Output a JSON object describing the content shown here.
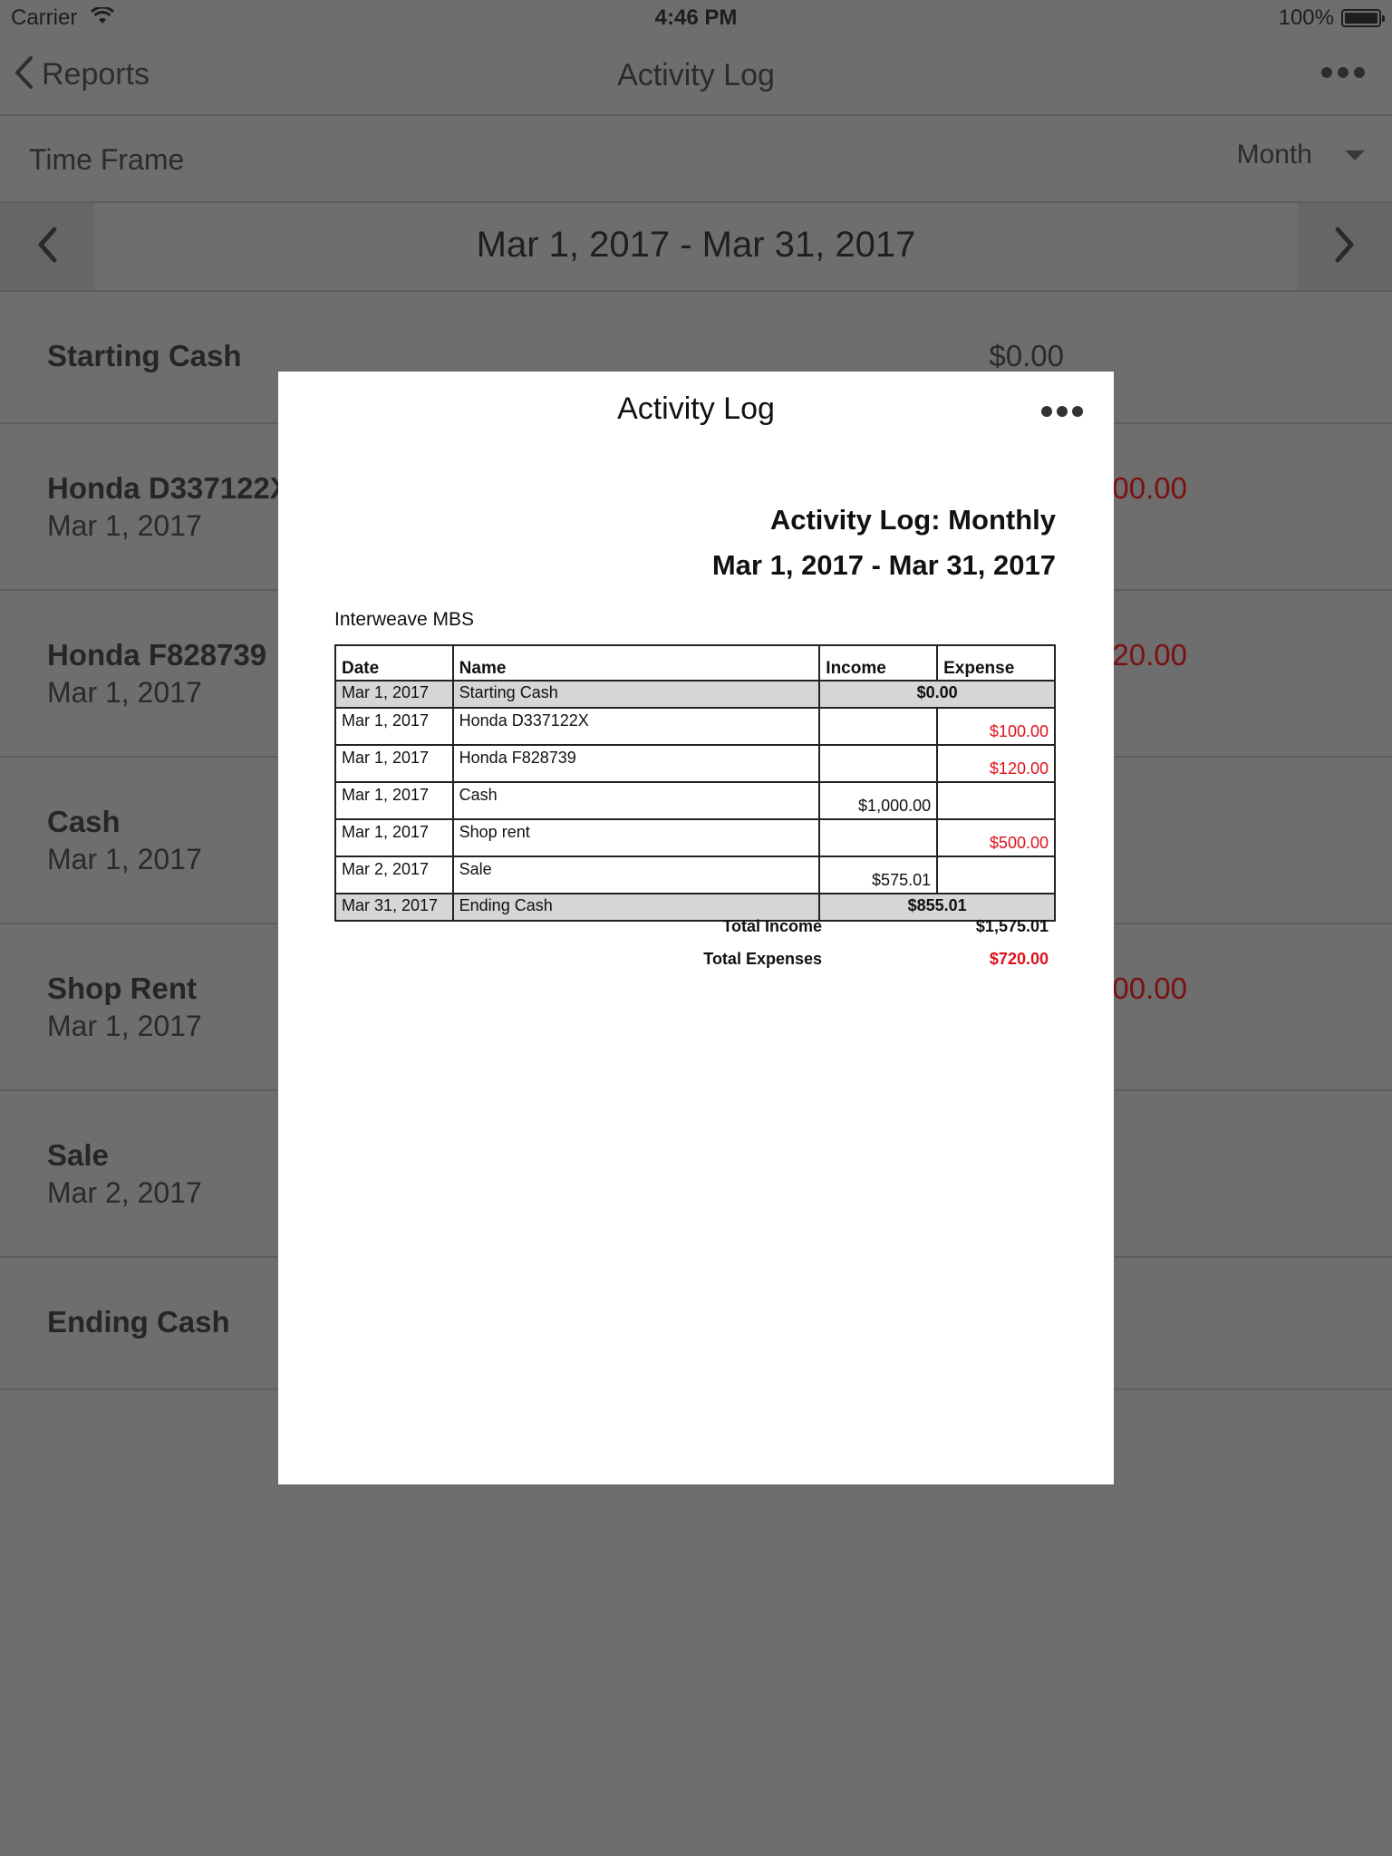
{
  "status_bar": {
    "carrier": "Carrier",
    "time": "4:46 PM",
    "battery": "100%"
  },
  "nav": {
    "back_label": "Reports",
    "title": "Activity Log"
  },
  "time_frame": {
    "label": "Time Frame",
    "value": "Month"
  },
  "date_range": "Mar 1, 2017 - Mar 31, 2017",
  "list": [
    {
      "name": "Starting Cash",
      "date": "",
      "amount": "$0.00",
      "expense": false
    },
    {
      "name": "Honda D337122X",
      "date": "Mar 1, 2017",
      "amount": "00.00",
      "expense": true
    },
    {
      "name": "Honda F828739",
      "date": "Mar 1, 2017",
      "amount": "20.00",
      "expense": true
    },
    {
      "name": "Cash",
      "date": "Mar 1, 2017",
      "amount": "",
      "expense": false
    },
    {
      "name": "Shop Rent",
      "date": "Mar 1, 2017",
      "amount": "00.00",
      "expense": true
    },
    {
      "name": "Sale",
      "date": "Mar 2, 2017",
      "amount": "",
      "expense": false
    },
    {
      "name": "Ending Cash",
      "date": "",
      "amount": "",
      "expense": false
    }
  ],
  "modal": {
    "title": "Activity Log",
    "report_title": "Activity Log: Monthly",
    "report_range": "Mar 1, 2017 - Mar 31, 2017",
    "company": "Interweave MBS",
    "columns": [
      "Date",
      "Name",
      "Income",
      "Expense"
    ],
    "starting_row": {
      "date": "Mar 1, 2017",
      "name": "Starting Cash",
      "amount": "$0.00"
    },
    "rows": [
      {
        "date": "Mar 1, 2017",
        "name": "Honda D337122X",
        "income": "",
        "expense": "$100.00"
      },
      {
        "date": "Mar 1, 2017",
        "name": "Honda F828739",
        "income": "",
        "expense": "$120.00"
      },
      {
        "date": "Mar 1, 2017",
        "name": "Cash",
        "income": "$1,000.00",
        "expense": ""
      },
      {
        "date": "Mar 1, 2017",
        "name": "Shop rent",
        "income": "",
        "expense": "$500.00"
      },
      {
        "date": "Mar 2, 2017",
        "name": "Sale",
        "income": "$575.01",
        "expense": ""
      }
    ],
    "ending_row": {
      "date": "Mar 31, 2017",
      "name": "Ending Cash",
      "amount": "$855.01"
    },
    "totals": {
      "income_label": "Total Income",
      "income_value": "$1,575.01",
      "expenses_label": "Total Expenses",
      "expenses_value": "$720.00"
    }
  },
  "colors": {
    "backdrop": "#6e6e6e",
    "expense_red": "#e0101a",
    "shaded_row": "#d6d6d6"
  }
}
